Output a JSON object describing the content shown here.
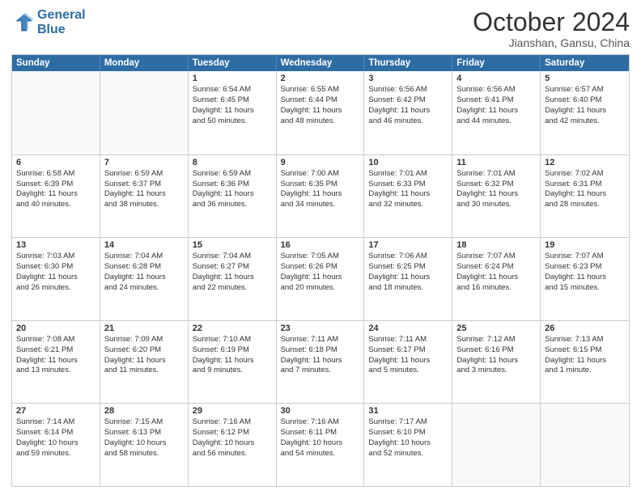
{
  "header": {
    "logo_line1": "General",
    "logo_line2": "Blue",
    "title": "October 2024",
    "subtitle": "Jianshan, Gansu, China"
  },
  "days_of_week": [
    "Sunday",
    "Monday",
    "Tuesday",
    "Wednesday",
    "Thursday",
    "Friday",
    "Saturday"
  ],
  "weeks": [
    [
      {
        "day": "",
        "info": [],
        "empty": true
      },
      {
        "day": "",
        "info": [],
        "empty": true
      },
      {
        "day": "1",
        "info": [
          "Sunrise: 6:54 AM",
          "Sunset: 6:45 PM",
          "Daylight: 11 hours",
          "and 50 minutes."
        ],
        "empty": false
      },
      {
        "day": "2",
        "info": [
          "Sunrise: 6:55 AM",
          "Sunset: 6:44 PM",
          "Daylight: 11 hours",
          "and 48 minutes."
        ],
        "empty": false
      },
      {
        "day": "3",
        "info": [
          "Sunrise: 6:56 AM",
          "Sunset: 6:42 PM",
          "Daylight: 11 hours",
          "and 46 minutes."
        ],
        "empty": false
      },
      {
        "day": "4",
        "info": [
          "Sunrise: 6:56 AM",
          "Sunset: 6:41 PM",
          "Daylight: 11 hours",
          "and 44 minutes."
        ],
        "empty": false
      },
      {
        "day": "5",
        "info": [
          "Sunrise: 6:57 AM",
          "Sunset: 6:40 PM",
          "Daylight: 11 hours",
          "and 42 minutes."
        ],
        "empty": false
      }
    ],
    [
      {
        "day": "6",
        "info": [
          "Sunrise: 6:58 AM",
          "Sunset: 6:39 PM",
          "Daylight: 11 hours",
          "and 40 minutes."
        ],
        "empty": false
      },
      {
        "day": "7",
        "info": [
          "Sunrise: 6:59 AM",
          "Sunset: 6:37 PM",
          "Daylight: 11 hours",
          "and 38 minutes."
        ],
        "empty": false
      },
      {
        "day": "8",
        "info": [
          "Sunrise: 6:59 AM",
          "Sunset: 6:36 PM",
          "Daylight: 11 hours",
          "and 36 minutes."
        ],
        "empty": false
      },
      {
        "day": "9",
        "info": [
          "Sunrise: 7:00 AM",
          "Sunset: 6:35 PM",
          "Daylight: 11 hours",
          "and 34 minutes."
        ],
        "empty": false
      },
      {
        "day": "10",
        "info": [
          "Sunrise: 7:01 AM",
          "Sunset: 6:33 PM",
          "Daylight: 11 hours",
          "and 32 minutes."
        ],
        "empty": false
      },
      {
        "day": "11",
        "info": [
          "Sunrise: 7:01 AM",
          "Sunset: 6:32 PM",
          "Daylight: 11 hours",
          "and 30 minutes."
        ],
        "empty": false
      },
      {
        "day": "12",
        "info": [
          "Sunrise: 7:02 AM",
          "Sunset: 6:31 PM",
          "Daylight: 11 hours",
          "and 28 minutes."
        ],
        "empty": false
      }
    ],
    [
      {
        "day": "13",
        "info": [
          "Sunrise: 7:03 AM",
          "Sunset: 6:30 PM",
          "Daylight: 11 hours",
          "and 26 minutes."
        ],
        "empty": false
      },
      {
        "day": "14",
        "info": [
          "Sunrise: 7:04 AM",
          "Sunset: 6:28 PM",
          "Daylight: 11 hours",
          "and 24 minutes."
        ],
        "empty": false
      },
      {
        "day": "15",
        "info": [
          "Sunrise: 7:04 AM",
          "Sunset: 6:27 PM",
          "Daylight: 11 hours",
          "and 22 minutes."
        ],
        "empty": false
      },
      {
        "day": "16",
        "info": [
          "Sunrise: 7:05 AM",
          "Sunset: 6:26 PM",
          "Daylight: 11 hours",
          "and 20 minutes."
        ],
        "empty": false
      },
      {
        "day": "17",
        "info": [
          "Sunrise: 7:06 AM",
          "Sunset: 6:25 PM",
          "Daylight: 11 hours",
          "and 18 minutes."
        ],
        "empty": false
      },
      {
        "day": "18",
        "info": [
          "Sunrise: 7:07 AM",
          "Sunset: 6:24 PM",
          "Daylight: 11 hours",
          "and 16 minutes."
        ],
        "empty": false
      },
      {
        "day": "19",
        "info": [
          "Sunrise: 7:07 AM",
          "Sunset: 6:23 PM",
          "Daylight: 11 hours",
          "and 15 minutes."
        ],
        "empty": false
      }
    ],
    [
      {
        "day": "20",
        "info": [
          "Sunrise: 7:08 AM",
          "Sunset: 6:21 PM",
          "Daylight: 11 hours",
          "and 13 minutes."
        ],
        "empty": false
      },
      {
        "day": "21",
        "info": [
          "Sunrise: 7:09 AM",
          "Sunset: 6:20 PM",
          "Daylight: 11 hours",
          "and 11 minutes."
        ],
        "empty": false
      },
      {
        "day": "22",
        "info": [
          "Sunrise: 7:10 AM",
          "Sunset: 6:19 PM",
          "Daylight: 11 hours",
          "and 9 minutes."
        ],
        "empty": false
      },
      {
        "day": "23",
        "info": [
          "Sunrise: 7:11 AM",
          "Sunset: 6:18 PM",
          "Daylight: 11 hours",
          "and 7 minutes."
        ],
        "empty": false
      },
      {
        "day": "24",
        "info": [
          "Sunrise: 7:11 AM",
          "Sunset: 6:17 PM",
          "Daylight: 11 hours",
          "and 5 minutes."
        ],
        "empty": false
      },
      {
        "day": "25",
        "info": [
          "Sunrise: 7:12 AM",
          "Sunset: 6:16 PM",
          "Daylight: 11 hours",
          "and 3 minutes."
        ],
        "empty": false
      },
      {
        "day": "26",
        "info": [
          "Sunrise: 7:13 AM",
          "Sunset: 6:15 PM",
          "Daylight: 11 hours",
          "and 1 minute."
        ],
        "empty": false
      }
    ],
    [
      {
        "day": "27",
        "info": [
          "Sunrise: 7:14 AM",
          "Sunset: 6:14 PM",
          "Daylight: 10 hours",
          "and 59 minutes."
        ],
        "empty": false
      },
      {
        "day": "28",
        "info": [
          "Sunrise: 7:15 AM",
          "Sunset: 6:13 PM",
          "Daylight: 10 hours",
          "and 58 minutes."
        ],
        "empty": false
      },
      {
        "day": "29",
        "info": [
          "Sunrise: 7:16 AM",
          "Sunset: 6:12 PM",
          "Daylight: 10 hours",
          "and 56 minutes."
        ],
        "empty": false
      },
      {
        "day": "30",
        "info": [
          "Sunrise: 7:16 AM",
          "Sunset: 6:11 PM",
          "Daylight: 10 hours",
          "and 54 minutes."
        ],
        "empty": false
      },
      {
        "day": "31",
        "info": [
          "Sunrise: 7:17 AM",
          "Sunset: 6:10 PM",
          "Daylight: 10 hours",
          "and 52 minutes."
        ],
        "empty": false
      },
      {
        "day": "",
        "info": [],
        "empty": true
      },
      {
        "day": "",
        "info": [],
        "empty": true
      }
    ]
  ]
}
